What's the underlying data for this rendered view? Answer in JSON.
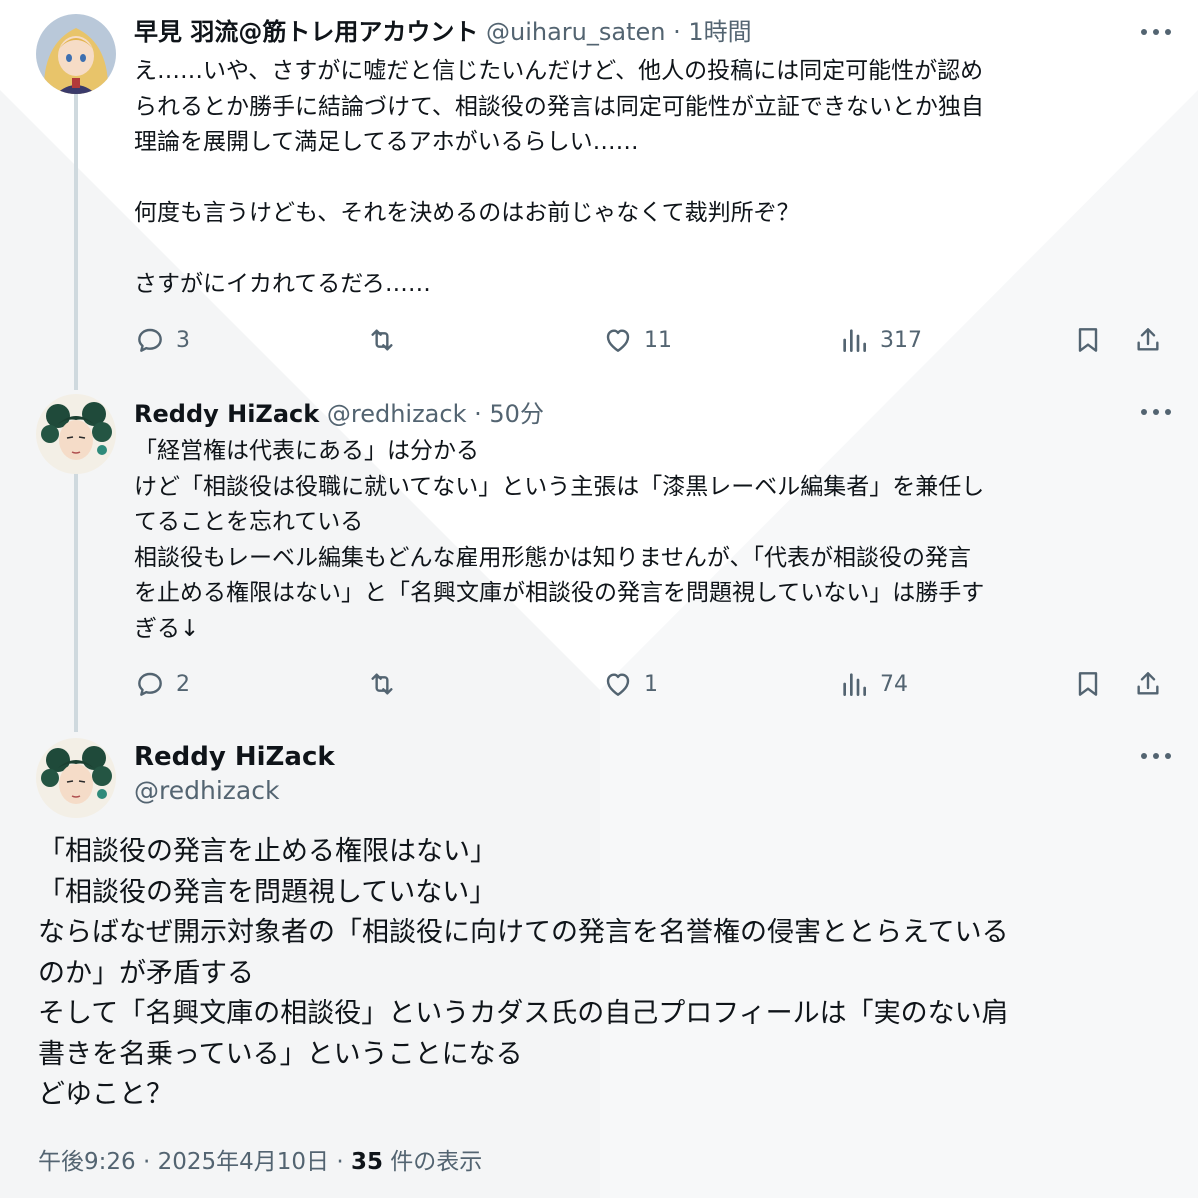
{
  "tweets": [
    {
      "display_name": "早見 羽流@筋トレ用アカウント",
      "handle": "@uiharu_saten",
      "separator": "·",
      "time": "1時間",
      "text": "え……いや、さすがに嘘だと信じたいんだけど、他人の投稿には同定可能性が認め\nられるとか勝手に結論づけて、相談役の発言は同定可能性が立証できないとか独自\n理論を展開して満足してるアホがいるらしい……\n\n何度も言うけども、それを決めるのはお前じゃなくて裁判所ぞ？\n\nさすがにイカれてるだろ……",
      "replies": "3",
      "retweets": "",
      "likes": "11",
      "views": "317"
    },
    {
      "display_name": "Reddy HiZack",
      "handle": "@redhizack",
      "separator": "·",
      "time": "50分",
      "text": "「経営権は代表にある」は分かる\nけど「相談役は役職に就いてない」という主張は「漆黒レーベル編集者」を兼任し\nてることを忘れている\n相談役もレーベル編集もどんな雇用形態かは知りませんが、「代表が相談役の発言\nを止める権限はない」と「名興文庫が相談役の発言を問題視していない」は勝手す\nぎる↓",
      "replies": "2",
      "retweets": "",
      "likes": "1",
      "views": "74"
    }
  ],
  "main_tweet": {
    "display_name": "Reddy HiZack",
    "handle": "@redhizack",
    "text": "「相談役の発言を止める権限はない」\n「相談役の発言を問題視していない」\nならばなぜ開示対象者の「相談役に向けての発言を名誉権の侵害ととらえている\nのか」が矛盾する\nそして「名興文庫の相談役」というカダス氏の自己プロフィールは「実のない肩\n書きを名乗っている」ということになる\nどゆこと？",
    "time": "午後9:26",
    "separator": "·",
    "date": "2025年4月10日",
    "views_count": "35",
    "views_label": "件の表示"
  },
  "icons": {
    "reply": "reply-icon",
    "retweet": "retweet-icon",
    "like": "heart-icon",
    "views": "views-chart-icon",
    "bookmark": "bookmark-icon",
    "share": "share-icon",
    "more": "more-dots-icon"
  },
  "colors": {
    "text": "#0f1419",
    "secondary": "#536471",
    "thread_line": "#cfd9de"
  }
}
